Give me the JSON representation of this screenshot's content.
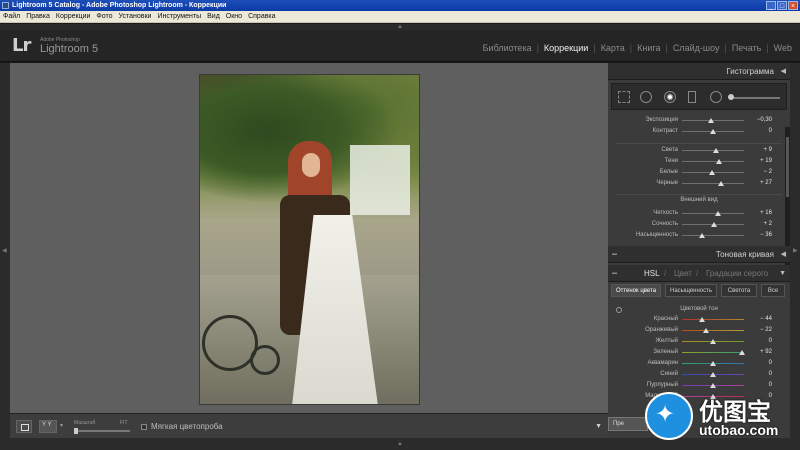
{
  "window": {
    "title": "Lightroom 5 Catalog - Adobe Photoshop Lightroom - Коррекции"
  },
  "menu": [
    "Файл",
    "Правка",
    "Коррекции",
    "Фото",
    "Установки",
    "Инструменты",
    "Вид",
    "Окно",
    "Справка"
  ],
  "identity": {
    "logo_mark": "Lr",
    "vendor": "Adobe Photoshop",
    "product": "Lightroom 5"
  },
  "modules": [
    {
      "label": "Библиотека",
      "active": false
    },
    {
      "label": "Коррекции",
      "active": true
    },
    {
      "label": "Карта",
      "active": false
    },
    {
      "label": "Книга",
      "active": false
    },
    {
      "label": "Слайд-шоу",
      "active": false
    },
    {
      "label": "Печать",
      "active": false
    },
    {
      "label": "Web",
      "active": false
    }
  ],
  "toolbar": {
    "zoom_label": "Масштаб",
    "zoom_fit": "FIT",
    "softproof_label": "Мягкая цветопроба"
  },
  "right_panel": {
    "histogram_title": "Гистограмма",
    "basic": [
      {
        "label": "Экспозиция",
        "value": "−0,30",
        "pos": 0.47
      },
      {
        "label": "Контраст",
        "value": "0",
        "pos": 0.5
      }
    ],
    "basic2": [
      {
        "label": "Света",
        "value": "+ 9",
        "pos": 0.55
      },
      {
        "label": "Тени",
        "value": "+ 19",
        "pos": 0.6
      },
      {
        "label": "Белые",
        "value": "− 2",
        "pos": 0.49
      },
      {
        "label": "Черные",
        "value": "+ 27",
        "pos": 0.63
      }
    ],
    "presence_label": "Внешний вид",
    "presence": [
      {
        "label": "Четкость",
        "value": "+ 16",
        "pos": 0.58
      },
      {
        "label": "Сочность",
        "value": "+ 2",
        "pos": 0.51
      },
      {
        "label": "Насыщенность",
        "value": "− 36",
        "pos": 0.32
      }
    ],
    "tone_curve_title": "Тоновая кривая",
    "hsl_tabs": [
      "HSL",
      "Цвет",
      "Градации серого"
    ],
    "hsl_subtabs": [
      "Оттенок цвета",
      "Насыщенность",
      "Светота",
      "Все"
    ],
    "hue_section_label": "Цветовой тон",
    "hue": [
      {
        "label": "Красный",
        "value": "− 44",
        "pos": 0.32,
        "c1": "#b03030",
        "c2": "#b08a30"
      },
      {
        "label": "Оранжевый",
        "value": "− 22",
        "pos": 0.39,
        "c1": "#b04a20",
        "c2": "#b0a030"
      },
      {
        "label": "Желтый",
        "value": "0",
        "pos": 0.5,
        "c1": "#b08a20",
        "c2": "#6aa030"
      },
      {
        "label": "Зеленый",
        "value": "+ 92",
        "pos": 0.97,
        "c1": "#90a030",
        "c2": "#30a070"
      },
      {
        "label": "Аквамарин",
        "value": "0",
        "pos": 0.5,
        "c1": "#30a070",
        "c2": "#3070b0"
      },
      {
        "label": "Синий",
        "value": "0",
        "pos": 0.5,
        "c1": "#3050b0",
        "c2": "#7040b0"
      },
      {
        "label": "Пурпурный",
        "value": "0",
        "pos": 0.5,
        "c1": "#7040b0",
        "c2": "#b040a0"
      },
      {
        "label": "Малиновый",
        "value": "0",
        "pos": 0.5,
        "c1": "#b040a0",
        "c2": "#b03040"
      }
    ],
    "prev_button": "Пре"
  },
  "watermark": {
    "cn": "优图宝",
    "url": "utobao.com"
  }
}
